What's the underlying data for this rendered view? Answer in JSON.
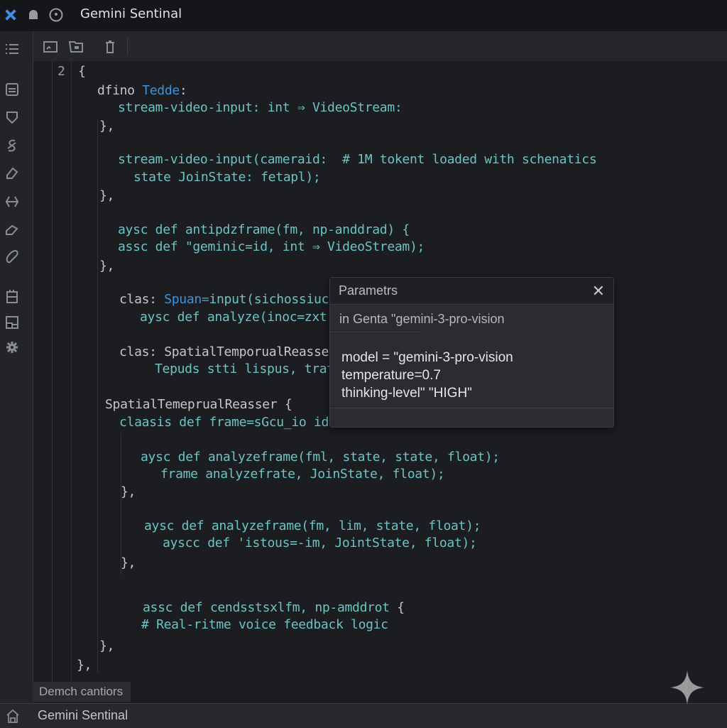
{
  "window": {
    "title": "Gemini Sentinal"
  },
  "titlebar_icons": [
    "satellite-icon",
    "bell-icon",
    "record-icon"
  ],
  "toolbar": {
    "icons": [
      "image-icon",
      "folder-image-icon",
      "trash-icon"
    ]
  },
  "sidebar": {
    "icons": [
      "list-icon",
      "document-icon",
      "shield-icon",
      "link-icon",
      "eraser-icon",
      "split-arrows-icon",
      "tag-icon",
      "pill-icon",
      "clipboard-icon",
      "layout-icon",
      "gear-icon"
    ]
  },
  "editor": {
    "line_number": "2",
    "lines": [
      [
        {
          "t": "{",
          "c": "gray"
        }
      ],
      [
        {
          "t": "dfino ",
          "c": "gray"
        },
        {
          "t": "Tedde",
          "c": "blue"
        },
        {
          "t": ":",
          "c": "gray"
        }
      ],
      [
        {
          "t": "stream-video-input: int ⇒ VideoStream:",
          "c": "teal"
        }
      ],
      [
        {
          "t": "},",
          "c": "gray"
        }
      ],
      [
        {
          "t": "stream-video-input(cameraid:  # 1M tokent loaded with schenatics",
          "c": "teal"
        }
      ],
      [
        {
          "t": "state JoinState: fetapl);",
          "c": "teal"
        }
      ],
      [
        {
          "t": "},",
          "c": "gray"
        }
      ],
      [
        {
          "t": "aysc def antipdzframe(fm, np-anddrad) {",
          "c": "teal"
        }
      ],
      [
        {
          "t": "assc def \"geminic=id, int ⇒ VideoStream);",
          "c": "teal"
        }
      ],
      [
        {
          "t": "},",
          "c": "gray"
        }
      ],
      [
        {
          "t": "clas: ",
          "c": "gray"
        },
        {
          "t": "Spuan=",
          "c": "blue"
        },
        {
          "t": "input(sichossiuct",
          "c": "teal"
        }
      ],
      [
        {
          "t": "aysc def analyze(inoc=zxt",
          "c": "teal"
        }
      ],
      [
        {
          "t": "clas: SpatialTemporualReasser",
          "c": "gray"
        }
      ],
      [
        {
          "t": "Tepuds stti lispus, trat",
          "c": "teal"
        }
      ],
      [
        {
          "t": "SpatialTemeprualReasser {",
          "c": "gray"
        }
      ],
      [
        {
          "t": "claasis def frame=sGcu_io id",
          "c": "teal"
        }
      ],
      [
        {
          "t": "aysc def analyzeframe(fml, state, state, float);",
          "c": "teal"
        }
      ],
      [
        {
          "t": "frame analyzefrate, JoinState, float);",
          "c": "teal"
        }
      ],
      [
        {
          "t": "},",
          "c": "gray"
        }
      ],
      [
        {
          "t": "aysc def analyzeframe(fm, lim, state, float);",
          "c": "teal"
        }
      ],
      [
        {
          "t": "ayscc def 'istous=-im, JointState, float);",
          "c": "teal"
        }
      ],
      [
        {
          "t": "},",
          "c": "gray"
        }
      ],
      [
        {
          "t": "assc def cendsstsxlfm, np-amddrot ",
          "c": "teal"
        },
        {
          "t": "{",
          "c": "gray"
        }
      ],
      [
        {
          "t": "# Real-ritme voice feedback logic",
          "c": "teal"
        }
      ],
      [
        {
          "t": "},",
          "c": "gray"
        }
      ],
      [
        {
          "t": "},",
          "c": "gray"
        }
      ]
    ]
  },
  "popup": {
    "title": "Parametrs",
    "close_icon": "close-icon",
    "subtitle": "in Genta \"gemini-3-pro-vision",
    "params": [
      "model = \"gemini-3-pro-vision",
      "temperature=0.7",
      "thinking-level\" \"HIGH\""
    ]
  },
  "bottom_tab": {
    "label": "Demch cantiors"
  },
  "statusbar": {
    "icon": "home-icon",
    "label": "Gemini Sentinal"
  },
  "watermark_icon": "sparkle-icon",
  "colors": {
    "code": "#6cc3c3",
    "keyword": "#c6c6c6",
    "type": "#3d93dc",
    "background": "#1b1d21",
    "accent": "#3d8fe0"
  }
}
